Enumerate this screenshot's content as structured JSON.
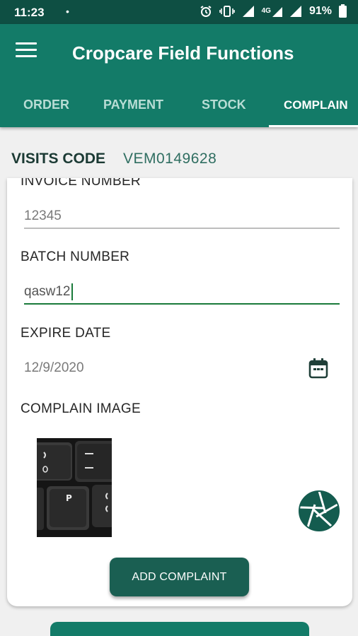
{
  "status_bar": {
    "time": "11:23",
    "dot": "•",
    "battery": "91%",
    "network": "4G"
  },
  "app_bar": {
    "title": "Cropcare Field Functions",
    "tabs": [
      {
        "label": "ORDER"
      },
      {
        "label": "PAYMENT"
      },
      {
        "label": "STOCK"
      },
      {
        "label": "COMPLAIN"
      }
    ],
    "active_tab": "COMPLAIN"
  },
  "visits": {
    "label": "VISITS CODE",
    "value": "VEM0149628"
  },
  "form": {
    "invoice": {
      "label": "INVOICE NUMBER",
      "value": "12345"
    },
    "batch": {
      "label": "BATCH NUMBER",
      "value": "qasw12"
    },
    "expire": {
      "label": "EXPIRE DATE",
      "value": "12/9/2020"
    },
    "image": {
      "label": "COMPLAIN IMAGE"
    },
    "submit_label": "ADD COMPLAINT"
  },
  "icons": {
    "menu": "menu-icon",
    "calendar": "calendar-icon",
    "camera": "camera-shutter-icon",
    "alarm": "alarm-icon",
    "vibrate": "vibrate-icon",
    "signal": "signal-icon",
    "battery": "battery-icon"
  },
  "colors": {
    "primary": "#137b68",
    "primary_dark": "#0e4f43",
    "button": "#1a5f52",
    "focus": "#1a7a3a"
  }
}
